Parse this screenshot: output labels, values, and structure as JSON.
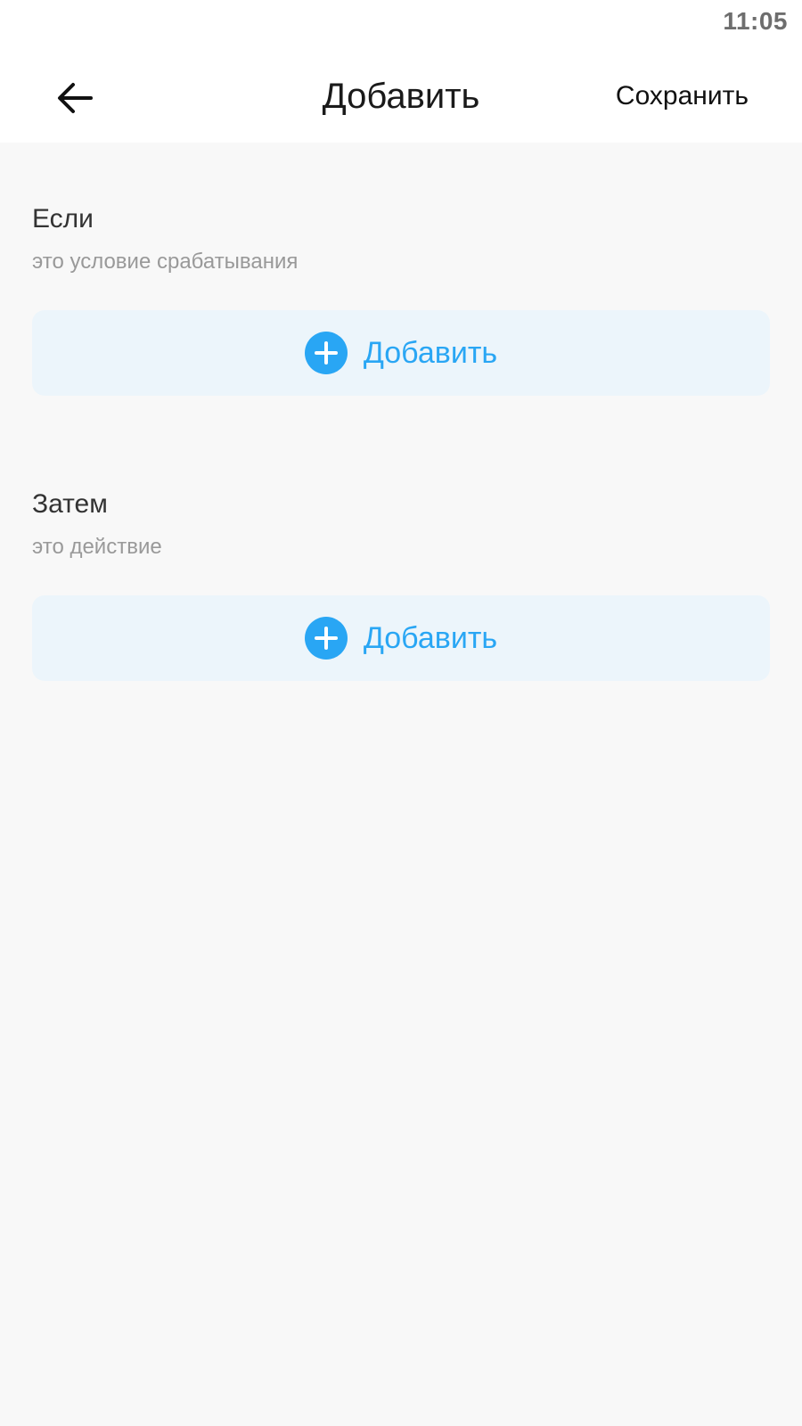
{
  "status_bar": {
    "time": "11:05"
  },
  "header": {
    "back_icon": "arrow-left-icon",
    "title": "Добавить",
    "save_label": "Сохранить"
  },
  "sections": [
    {
      "title": "Если",
      "subtitle": "это условие срабатывания",
      "add_label": "Добавить",
      "add_icon": "plus-circle-icon"
    },
    {
      "title": "Затем",
      "subtitle": "это действие",
      "add_label": "Добавить",
      "add_icon": "plus-circle-icon"
    }
  ],
  "colors": {
    "accent": "#29a6f4",
    "card_background": "#ecf5fb",
    "page_background": "#f8f8f8"
  }
}
